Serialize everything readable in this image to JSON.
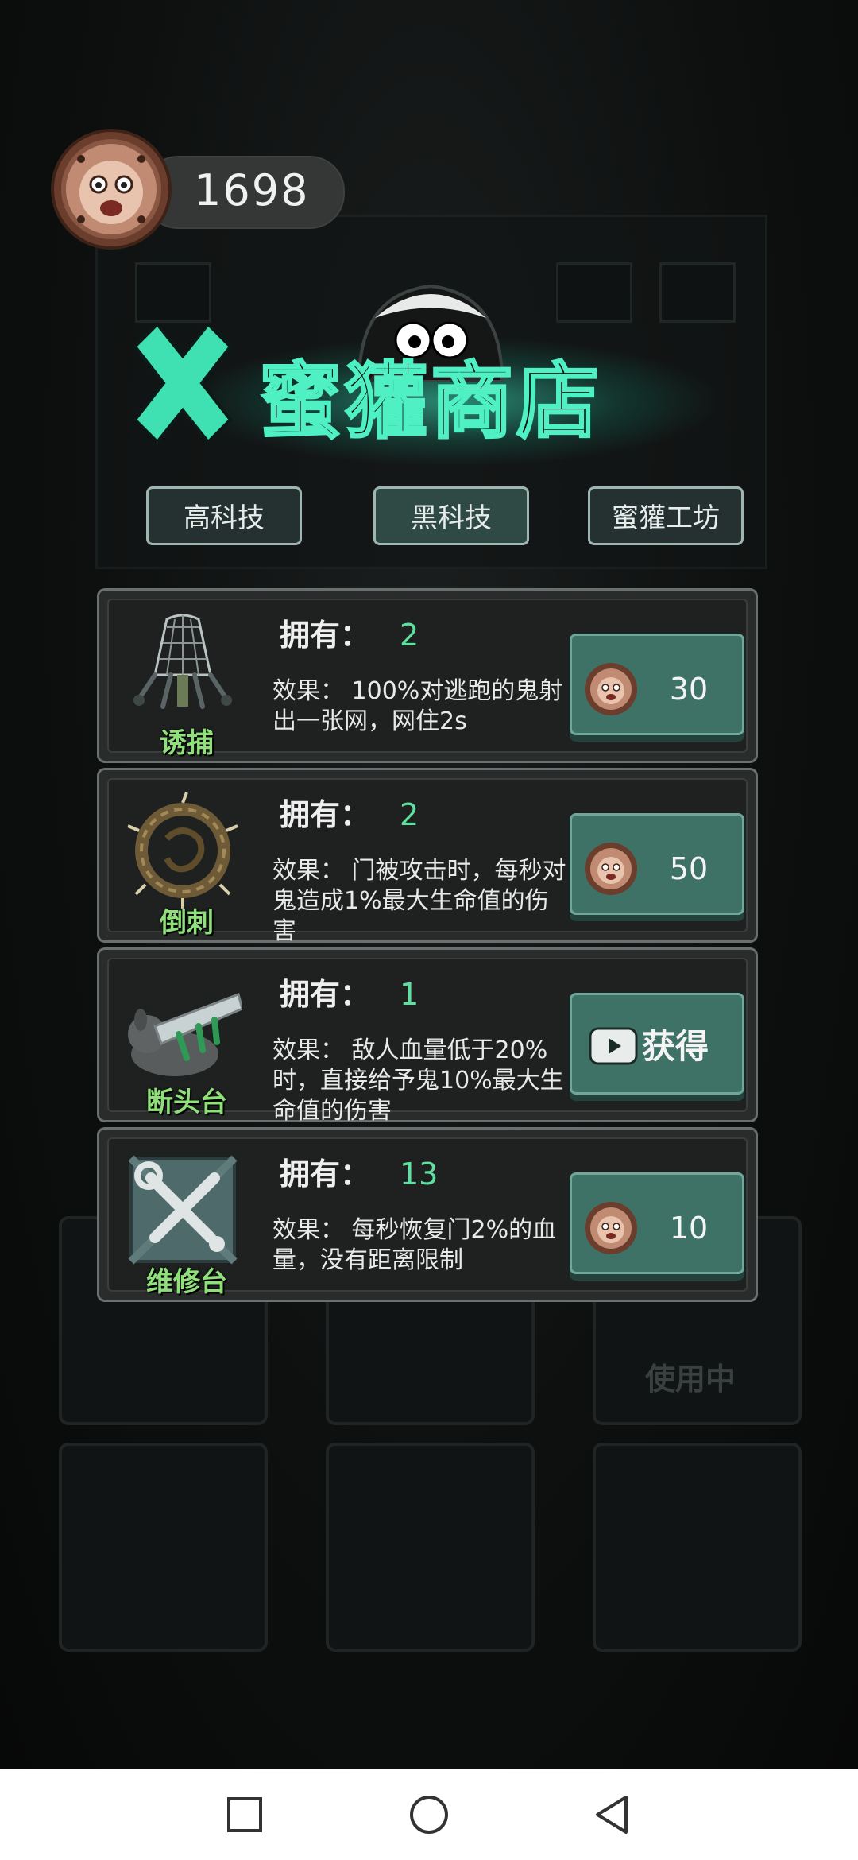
{
  "header": {
    "coin_count": "1698"
  },
  "shop": {
    "title": "蜜獾商店",
    "close_icon": "close-x-icon"
  },
  "tabs": [
    {
      "label": "高科技",
      "active": false
    },
    {
      "label": "黑科技",
      "active": true
    },
    {
      "label": "蜜獾工坊",
      "active": false
    }
  ],
  "items": [
    {
      "name": "诱捕",
      "own_label": "拥有：",
      "own_value": "2",
      "effect": "效果：    100%对逃跑的鬼射出一张网，网住2s",
      "price": "30",
      "action": "coin"
    },
    {
      "name": "倒刺",
      "own_label": "拥有：",
      "own_value": "2",
      "effect": "效果：    门被攻击时，每秒对鬼造成1%最大生命值的伤害",
      "price": "50",
      "action": "coin"
    },
    {
      "name": "断头台",
      "own_label": "拥有：",
      "own_value": "1",
      "effect": "效果：    敌人血量低于20%时，直接给予鬼10%最大生命值的伤害",
      "price": "获得",
      "action": "video"
    },
    {
      "name": "维修台",
      "own_label": "拥有：",
      "own_value": "13",
      "effect": "效果：    每秒恢复门2%的血量，没有距离限制",
      "price": "10",
      "action": "coin"
    }
  ],
  "background": {
    "status_text": "使用中"
  },
  "colors": {
    "accent": "#4ff0c4",
    "button": "#3f7267",
    "own_value": "#5fe0a0",
    "item_name": "#8fe07a"
  }
}
